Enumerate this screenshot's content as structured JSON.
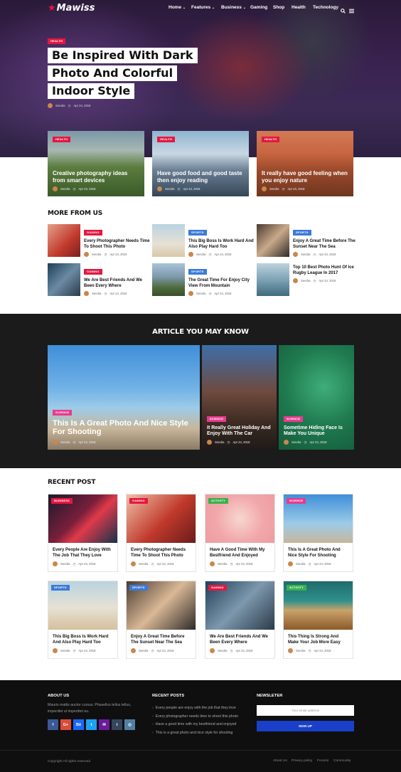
{
  "brand": {
    "name": "Mawiss",
    "accent": "#e5173f"
  },
  "nav": {
    "items": [
      "Home",
      "Features",
      "Business",
      "Gaming",
      "Shop",
      "Health",
      "Technology"
    ]
  },
  "hero": {
    "tag": "HEALTH",
    "title_lines": [
      "Be Inspired With Dark",
      "Photo And Colorful",
      "Indoor Style"
    ],
    "author": "Sendra",
    "date": "Apr 24, 2018"
  },
  "featured": [
    {
      "tag": "HEALTH",
      "title": "Creative photography ideas from smart devices",
      "author": "Sendra",
      "date": "Apr 23, 2018"
    },
    {
      "tag": "HEALTH",
      "title": "Have good food and good taste then enjoy reading",
      "author": "Sendra",
      "date": "Apr 23, 2018"
    },
    {
      "tag": "HEALTH",
      "title": "It really have good feeling when you enjoy nature",
      "author": "Sendra",
      "date": "Apr 23, 2018"
    }
  ],
  "more": {
    "heading": "MORE FROM US",
    "items": [
      {
        "tag": "GAMING",
        "title": "Every Photographer Needs Time To Shoot This Photo",
        "author": "Sendra",
        "date": "Apr 24, 2018"
      },
      {
        "tag": "SPORTS",
        "title": "This Big Boss Is Work Hard And Also Play Hard Too",
        "author": "Sendra",
        "date": "Apr 24, 2018"
      },
      {
        "tag": "SPORTS",
        "title": "Enjoy A Great Time Before The Sunset Near The Sea",
        "author": "Sendra",
        "date": "Apr 24, 2018"
      },
      {
        "tag": "GAMING",
        "title": "We Are Best Friends And We Been Every Where",
        "author": "Sendra",
        "date": "Apr 24, 2018"
      },
      {
        "tag": "SPORTS",
        "title": "The Great Time For Enjoy City View From Mountain",
        "author": "Sendra",
        "date": "Apr 24, 2018"
      },
      {
        "tag": "",
        "title": "Top 10 Best Photo Hunt Of Ice Rugby League In 2017",
        "author": "Sendra",
        "date": "Apr 24, 2018"
      }
    ]
  },
  "know": {
    "heading": "ARTICLE YOU MAY KNOW",
    "items": [
      {
        "tag": "SCIENCE",
        "title": "This Is A Great Photo And Nice Style For Shooting",
        "author": "Sendra",
        "date": "Apr 24, 2018"
      },
      {
        "tag": "SCIENCE",
        "title": "It Really Great Holiday And Enjoy With The Car",
        "author": "Sendra",
        "date": "Apr 24, 2018"
      },
      {
        "tag": "SCIENCE",
        "title": "Sometime Hiding Face Is Make You Unique",
        "author": "Sendra",
        "date": "Apr 24, 2018"
      }
    ]
  },
  "recent": {
    "heading": "RECENT POST",
    "items": [
      {
        "tag": "BUSINESS",
        "title": "Every People Are Enjoy With The Job That They Love",
        "author": "Sendra",
        "date": "Apr 24, 2018"
      },
      {
        "tag": "GAMING",
        "title": "Every Photographer Needs Time To Shoot This Photo",
        "author": "Sendra",
        "date": "Apr 24, 2018"
      },
      {
        "tag": "ACTIVITY",
        "title": "Have A Good Time With My Bestfriend And Enjoyed",
        "author": "Sendra",
        "date": "Apr 24, 2018"
      },
      {
        "tag": "SCIENCE",
        "title": "This Is A Great Photo And Nice Style For Shooting",
        "author": "Sendra",
        "date": "Apr 24, 2018"
      },
      {
        "tag": "SPORTS",
        "title": "This Big Boss Is Work Hard And Also Play Hard Too",
        "author": "Sendra",
        "date": "Apr 24, 2018"
      },
      {
        "tag": "SPORTS",
        "title": "Enjoy A Great Time Before The Sunset Near The Sea",
        "author": "Sendra",
        "date": "Apr 24, 2018"
      },
      {
        "tag": "GAMING",
        "title": "We Are Best Friends And We Been Every Where",
        "author": "Sendra",
        "date": "Apr 24, 2018"
      },
      {
        "tag": "ACTIVITY",
        "title": "This Thing Is Strong And Make Your Job More Easy",
        "author": "Sendra",
        "date": "Apr 24, 2018"
      }
    ]
  },
  "footer": {
    "about_heading": "ABOUT US",
    "about_text": "Mauris mattis auctor cursus. Phasellus tellus tellus, imperdiet ut imperdiet eu.",
    "social": [
      "f",
      "G+",
      "Bē",
      "t",
      "✉",
      "t",
      "◎"
    ],
    "recent_heading": "RECENT POSTS",
    "recent_posts": [
      "Every people are enjoy with the job that they love",
      "Every photographer needs time to shoot this photo",
      "Have a good time with my bestfriend and enjoyed",
      "This is a great photo and nice style for shooting"
    ],
    "newsletter_heading": "NEWSLETER",
    "email_placeholder": "Your email address",
    "signup_label": "SIGN UP",
    "copyright": "Copyright All rights reserved",
    "links": [
      "About Us",
      "Privacy policy",
      "Forums",
      "Community"
    ]
  }
}
